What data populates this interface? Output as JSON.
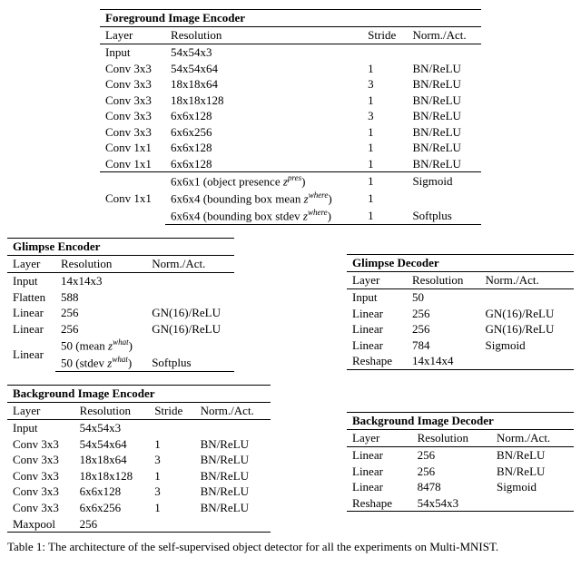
{
  "fg_encoder": {
    "title": "Foreground Image Encoder",
    "headers": {
      "layer": "Layer",
      "res": "Resolution",
      "stride": "Stride",
      "norm": "Norm./Act."
    },
    "rows": [
      {
        "layer": "Input",
        "res": "54x54x3",
        "stride": "",
        "norm": ""
      },
      {
        "layer": "Conv 3x3",
        "res": "54x54x64",
        "stride": "1",
        "norm": "BN/ReLU"
      },
      {
        "layer": "Conv 3x3",
        "res": "18x18x64",
        "stride": "3",
        "norm": "BN/ReLU"
      },
      {
        "layer": "Conv 3x3",
        "res": "18x18x128",
        "stride": "1",
        "norm": "BN/ReLU"
      },
      {
        "layer": "Conv 3x3",
        "res": "6x6x128",
        "stride": "3",
        "norm": "BN/ReLU"
      },
      {
        "layer": "Conv 3x3",
        "res": "6x6x256",
        "stride": "1",
        "norm": "BN/ReLU"
      },
      {
        "layer": "Conv 1x1",
        "res": "6x6x128",
        "stride": "1",
        "norm": "BN/ReLU"
      },
      {
        "layer": "Conv 1x1",
        "res": "6x6x128",
        "stride": "1",
        "norm": "BN/ReLU"
      }
    ],
    "tail_layer": "Conv 1x1",
    "tail": [
      {
        "res_a": "6x6x1 (object presence ",
        "res_sup": "pres",
        "res_b": ")",
        "stride": "1",
        "norm": "Sigmoid"
      },
      {
        "res_a": "6x6x4 (bounding box mean ",
        "res_sup": "where",
        "res_b": ")",
        "stride": "1",
        "norm": ""
      },
      {
        "res_a": "6x6x4 (bounding box stdev ",
        "res_sup": "where",
        "res_b": ")",
        "stride": "1",
        "norm": "Softplus"
      }
    ]
  },
  "glimpse_encoder": {
    "title": "Glimpse Encoder",
    "headers": {
      "layer": "Layer",
      "res": "Resolution",
      "norm": "Norm./Act."
    },
    "rows": [
      {
        "layer": "Input",
        "res": "14x14x3",
        "norm": ""
      },
      {
        "layer": "Flatten",
        "res": "588",
        "norm": ""
      },
      {
        "layer": "Linear",
        "res": "256",
        "norm": "GN(16)/ReLU"
      },
      {
        "layer": "Linear",
        "res": "256",
        "norm": "GN(16)/ReLU"
      }
    ],
    "tail_layer": "Linear",
    "tail": [
      {
        "res_a": "50 (mean ",
        "res_sup": "what",
        "res_b": ")",
        "norm": ""
      },
      {
        "res_a": "50 (stdev ",
        "res_sup": "what",
        "res_b": ")",
        "norm": "Softplus"
      }
    ]
  },
  "glimpse_decoder": {
    "title": "Glimpse Decoder",
    "headers": {
      "layer": "Layer",
      "res": "Resolution",
      "norm": "Norm./Act."
    },
    "rows": [
      {
        "layer": "Input",
        "res": "50",
        "norm": ""
      },
      {
        "layer": "Linear",
        "res": "256",
        "norm": "GN(16)/ReLU"
      },
      {
        "layer": "Linear",
        "res": "256",
        "norm": "GN(16)/ReLU"
      },
      {
        "layer": "Linear",
        "res": "784",
        "norm": "Sigmoid"
      },
      {
        "layer": "Reshape",
        "res": "14x14x4",
        "norm": ""
      }
    ]
  },
  "bg_encoder": {
    "title": "Background Image Encoder",
    "headers": {
      "layer": "Layer",
      "res": "Resolution",
      "stride": "Stride",
      "norm": "Norm./Act."
    },
    "rows": [
      {
        "layer": "Input",
        "res": "54x54x3",
        "stride": "",
        "norm": ""
      },
      {
        "layer": "Conv 3x3",
        "res": "54x54x64",
        "stride": "1",
        "norm": "BN/ReLU"
      },
      {
        "layer": "Conv 3x3",
        "res": "18x18x64",
        "stride": "3",
        "norm": "BN/ReLU"
      },
      {
        "layer": "Conv 3x3",
        "res": "18x18x128",
        "stride": "1",
        "norm": "BN/ReLU"
      },
      {
        "layer": "Conv 3x3",
        "res": "6x6x128",
        "stride": "3",
        "norm": "BN/ReLU"
      },
      {
        "layer": "Conv 3x3",
        "res": "6x6x256",
        "stride": "1",
        "norm": "BN/ReLU"
      },
      {
        "layer": "Maxpool",
        "res": "256",
        "stride": "",
        "norm": ""
      }
    ]
  },
  "bg_decoder": {
    "title": "Background Image Decoder",
    "headers": {
      "layer": "Layer",
      "res": "Resolution",
      "norm": "Norm./Act."
    },
    "rows": [
      {
        "layer": "Linear",
        "res": "256",
        "norm": "BN/ReLU"
      },
      {
        "layer": "Linear",
        "res": "256",
        "norm": "BN/ReLU"
      },
      {
        "layer": "Linear",
        "res": "8478",
        "norm": "Sigmoid"
      },
      {
        "layer": "Reshape",
        "res": "54x54x3",
        "norm": ""
      }
    ]
  },
  "caption": "Table 1: The architecture of the self-supervised object detector for all the experiments on Multi-MNIST.",
  "chart_data": [
    {
      "type": "table",
      "title": "Foreground Image Encoder",
      "columns": [
        "Layer",
        "Resolution",
        "Stride",
        "Norm./Act."
      ],
      "rows": [
        [
          "Input",
          "54x54x3",
          "",
          ""
        ],
        [
          "Conv 3x3",
          "54x54x64",
          "1",
          "BN/ReLU"
        ],
        [
          "Conv 3x3",
          "18x18x64",
          "3",
          "BN/ReLU"
        ],
        [
          "Conv 3x3",
          "18x18x128",
          "1",
          "BN/ReLU"
        ],
        [
          "Conv 3x3",
          "6x6x128",
          "3",
          "BN/ReLU"
        ],
        [
          "Conv 3x3",
          "6x6x256",
          "1",
          "BN/ReLU"
        ],
        [
          "Conv 1x1",
          "6x6x128",
          "1",
          "BN/ReLU"
        ],
        [
          "Conv 1x1",
          "6x6x128",
          "1",
          "BN/ReLU"
        ],
        [
          "Conv 1x1",
          "6x6x1 (object presence z^pres)",
          "1",
          "Sigmoid"
        ],
        [
          "Conv 1x1",
          "6x6x4 (bounding box mean z^where)",
          "1",
          ""
        ],
        [
          "Conv 1x1",
          "6x6x4 (bounding box stdev z^where)",
          "1",
          "Softplus"
        ]
      ]
    },
    {
      "type": "table",
      "title": "Glimpse Encoder",
      "columns": [
        "Layer",
        "Resolution",
        "Norm./Act."
      ],
      "rows": [
        [
          "Input",
          "14x14x3",
          ""
        ],
        [
          "Flatten",
          "588",
          ""
        ],
        [
          "Linear",
          "256",
          "GN(16)/ReLU"
        ],
        [
          "Linear",
          "256",
          "GN(16)/ReLU"
        ],
        [
          "Linear",
          "50 (mean z^what)",
          ""
        ],
        [
          "Linear",
          "50 (stdev z^what)",
          "Softplus"
        ]
      ]
    },
    {
      "type": "table",
      "title": "Glimpse Decoder",
      "columns": [
        "Layer",
        "Resolution",
        "Norm./Act."
      ],
      "rows": [
        [
          "Input",
          "50",
          ""
        ],
        [
          "Linear",
          "256",
          "GN(16)/ReLU"
        ],
        [
          "Linear",
          "256",
          "GN(16)/ReLU"
        ],
        [
          "Linear",
          "784",
          "Sigmoid"
        ],
        [
          "Reshape",
          "14x14x4",
          ""
        ]
      ]
    },
    {
      "type": "table",
      "title": "Background Image Encoder",
      "columns": [
        "Layer",
        "Resolution",
        "Stride",
        "Norm./Act."
      ],
      "rows": [
        [
          "Input",
          "54x54x3",
          "",
          ""
        ],
        [
          "Conv 3x3",
          "54x54x64",
          "1",
          "BN/ReLU"
        ],
        [
          "Conv 3x3",
          "18x18x64",
          "3",
          "BN/ReLU"
        ],
        [
          "Conv 3x3",
          "18x18x128",
          "1",
          "BN/ReLU"
        ],
        [
          "Conv 3x3",
          "6x6x128",
          "3",
          "BN/ReLU"
        ],
        [
          "Conv 3x3",
          "6x6x256",
          "1",
          "BN/ReLU"
        ],
        [
          "Maxpool",
          "256",
          "",
          ""
        ]
      ]
    },
    {
      "type": "table",
      "title": "Background Image Decoder",
      "columns": [
        "Layer",
        "Resolution",
        "Norm./Act."
      ],
      "rows": [
        [
          "Linear",
          "256",
          "BN/ReLU"
        ],
        [
          "Linear",
          "256",
          "BN/ReLU"
        ],
        [
          "Linear",
          "8478",
          "Sigmoid"
        ],
        [
          "Reshape",
          "54x54x3",
          ""
        ]
      ]
    }
  ]
}
